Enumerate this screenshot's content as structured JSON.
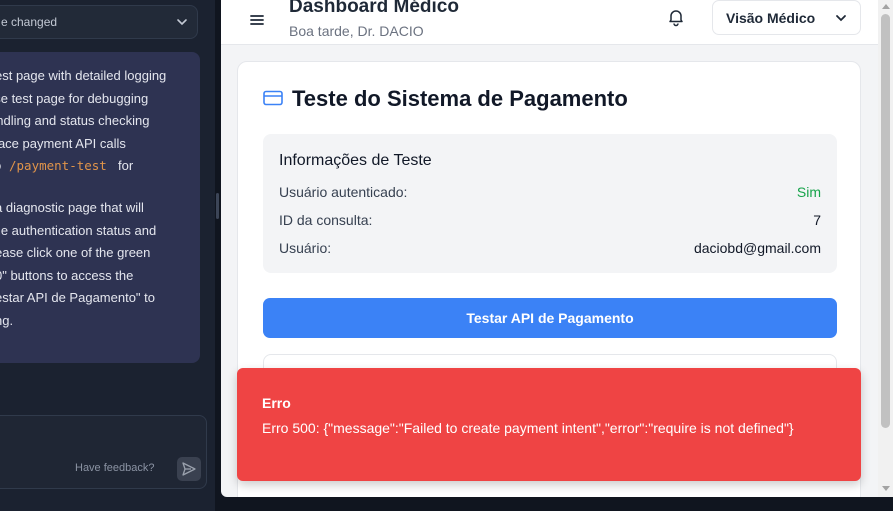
{
  "assistant": {
    "dropdown_label": "e changed",
    "message_lines_a": [
      "est page with detailed logging",
      "use test page for debugging",
      "andling and status checking",
      "trace payment API calls"
    ],
    "route_prefix": "o",
    "route_code": "/payment-test",
    "route_suffix": "for",
    "message_lines_b": [
      "a diagnostic page that will",
      " the authentication status and",
      "ease click one of the green",
      "0\" buttons to access the",
      "estar API de Pagamento\" to",
      "ng."
    ],
    "feedback_label": "Have feedback?",
    "icons": {
      "dropdown": "chevron-down-icon",
      "send": "send-icon"
    }
  },
  "header": {
    "title": "Dashboard Médico",
    "subtitle": "Boa tarde, Dr. DACIO",
    "role_select": "Visão Médico",
    "icons": {
      "menu": "hamburger-icon",
      "bell": "bell-icon",
      "select": "chevron-down-icon"
    }
  },
  "card": {
    "title": "Teste do Sistema de Pagamento",
    "icon": "credit-card-icon",
    "info": {
      "heading": "Informações de Teste",
      "rows": [
        {
          "label": "Usuário autenticado:",
          "value": "Sim"
        },
        {
          "label": "ID da consulta:",
          "value": "7"
        },
        {
          "label": "Usuário:",
          "value": "daciobd@gmail.com"
        }
      ]
    },
    "test_button": "Testar API de Pagamento"
  },
  "error": {
    "title": "Erro",
    "message": "Erro 500: {\"message\":\"Failed to create payment intent\",\"error\":\"require is not defined\"}"
  },
  "colors": {
    "accent_blue": "#3b82f6",
    "error_red": "#ef4444",
    "success_green": "#16a34a",
    "assistant_message_bg": "#2e3352"
  }
}
